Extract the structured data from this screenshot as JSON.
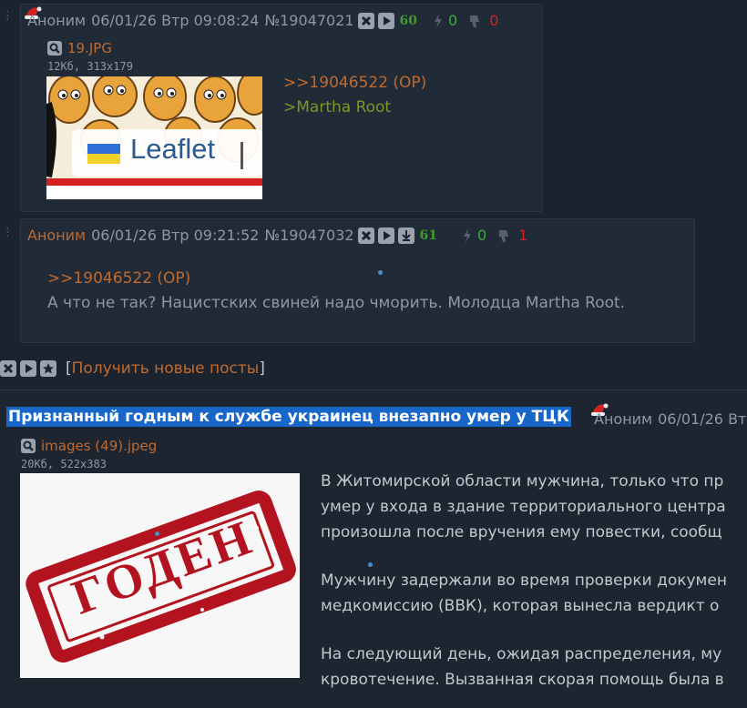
{
  "post1": {
    "name": "Аноним",
    "datetime": "06/01/26 Втр 09:08:24",
    "number": "№19047021",
    "count": "60",
    "likes": "0",
    "dislikes": "0",
    "file_name": "19.JPG",
    "file_meta": "12Кб, 313x179",
    "thumb_text": "Leaflet",
    "link": ">>19046522 (OP)",
    "quote": ">Martha Root"
  },
  "post2": {
    "name": "Аноним",
    "datetime": "06/01/26 Втр 09:21:52",
    "number": "№19047032",
    "count": "61",
    "likes": "0",
    "dislikes": "1",
    "link": ">>19046522 (OP)",
    "text": "А что не так? Нацистских свиней надо чморить. Молодца Martha Root."
  },
  "thread_controls": {
    "bracket_open": "[",
    "get_new_label": "Получить новые посты",
    "bracket_close": "]"
  },
  "op": {
    "title": "Признанный годным к службе украинец внезапно умер у ТЦК",
    "name": "Аноним",
    "datetime": "06/01/26 Вт",
    "file_name": "images (49).jpeg",
    "file_meta": "20Кб, 522x383",
    "stamp_text": "ГОДЕН",
    "lines": [
      "В Житомирской области мужчина, только что пр",
      "умер у входа в здание территориального центра",
      "произошла после вручения ему повестки, сообщ",
      "",
      "Мужчину задержали во время проверки докумен",
      "медкомиссию (ВВК), которая вынесла вердикт о",
      "",
      "На следующий день, ожидая распределения, му",
      "кровотечение. Вызванная скорая помощь была в"
    ]
  },
  "colors": {
    "background": "#1b232e",
    "post_bg": "#212a37",
    "name": "#c06a2e",
    "quote": "#789922",
    "like": "#3fa83f",
    "dislike": "#d32020",
    "highlight": "#1867c8"
  },
  "icons": [
    "santa-hat-icon",
    "hide-icon",
    "play-icon",
    "download-icon",
    "star-icon",
    "magnifier-icon",
    "like-icon",
    "dislike-icon"
  ]
}
